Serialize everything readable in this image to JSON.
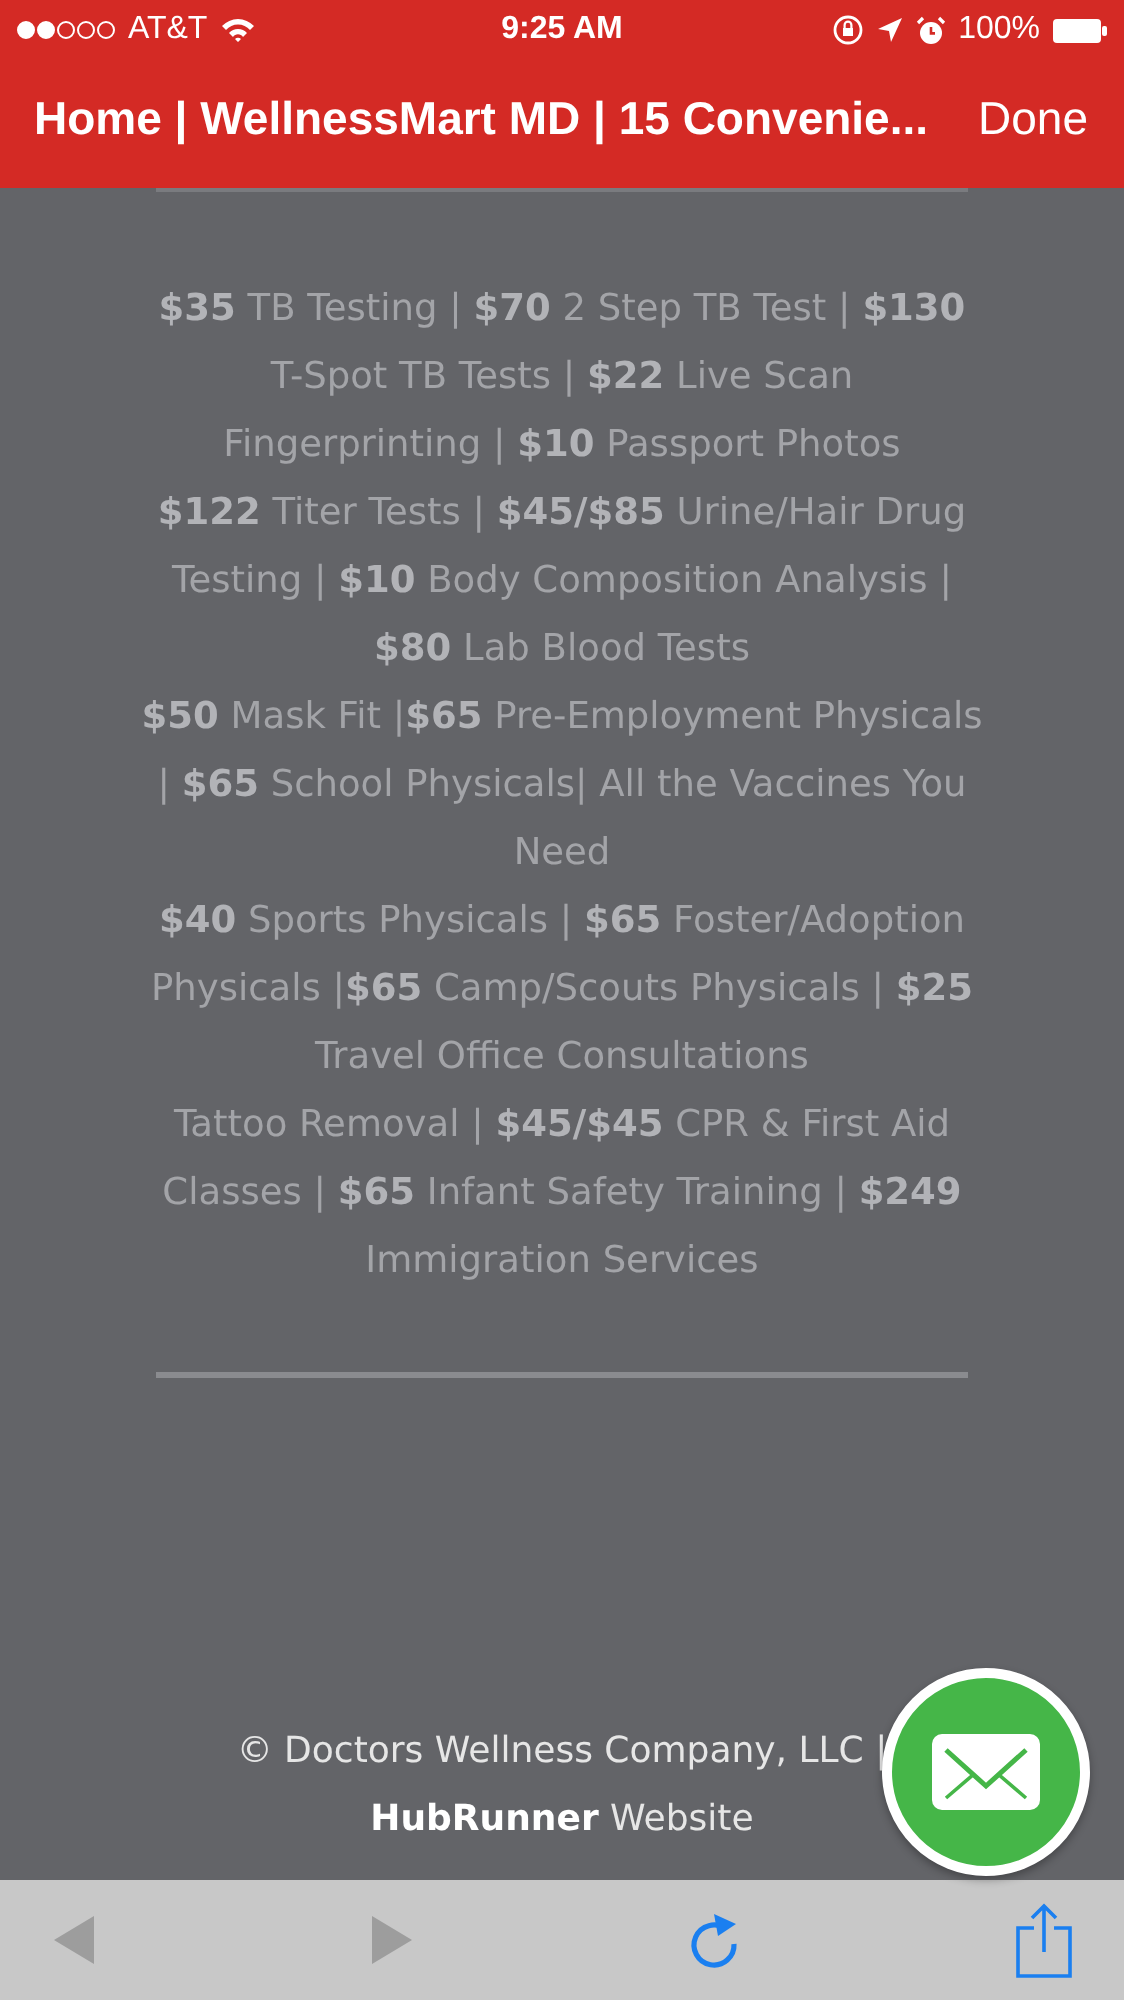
{
  "status_bar": {
    "carrier": "AT&T",
    "time": "9:25 AM",
    "battery": "100%"
  },
  "nav_bar": {
    "title": "Home | WellnessMart MD | 15 Convenie...",
    "done": "Done"
  },
  "paragraphs": [
    "**$35** TB Testing | **$70** 2 Step TB Test | **$130** T-Spot TB Tests | **$22** Live Scan Fingerprinting | **$10** Passport Photos",
    "**$122** Titer Tests | **$45/$85** Urine/Hair Drug Testing | **$10** Body Composition Analysis | **$80** Lab Blood Tests",
    "**$50** Mask Fit |**$65** Pre-Employment Physicals | **$65** School Physicals| All the Vaccines You Need",
    "**$40** Sports Physicals | **$65** Foster/Adoption Physicals |**$65** Camp/Scouts Physicals | **$25** Travel Office Consultations",
    "Tattoo Removal | **$45/$45** CPR & First Aid Classes | **$65** Infant Safety Training | **$249** Immigration Services"
  ],
  "footer": "© Doctors Wellness Company, LLC | **HubRunner** Website",
  "toolbar": [
    {
      "kind": "back",
      "disabled": true
    },
    {
      "kind": "forward",
      "disabled": true
    },
    {
      "kind": "reload",
      "disabled": false
    },
    {
      "kind": "share",
      "disabled": false
    }
  ]
}
